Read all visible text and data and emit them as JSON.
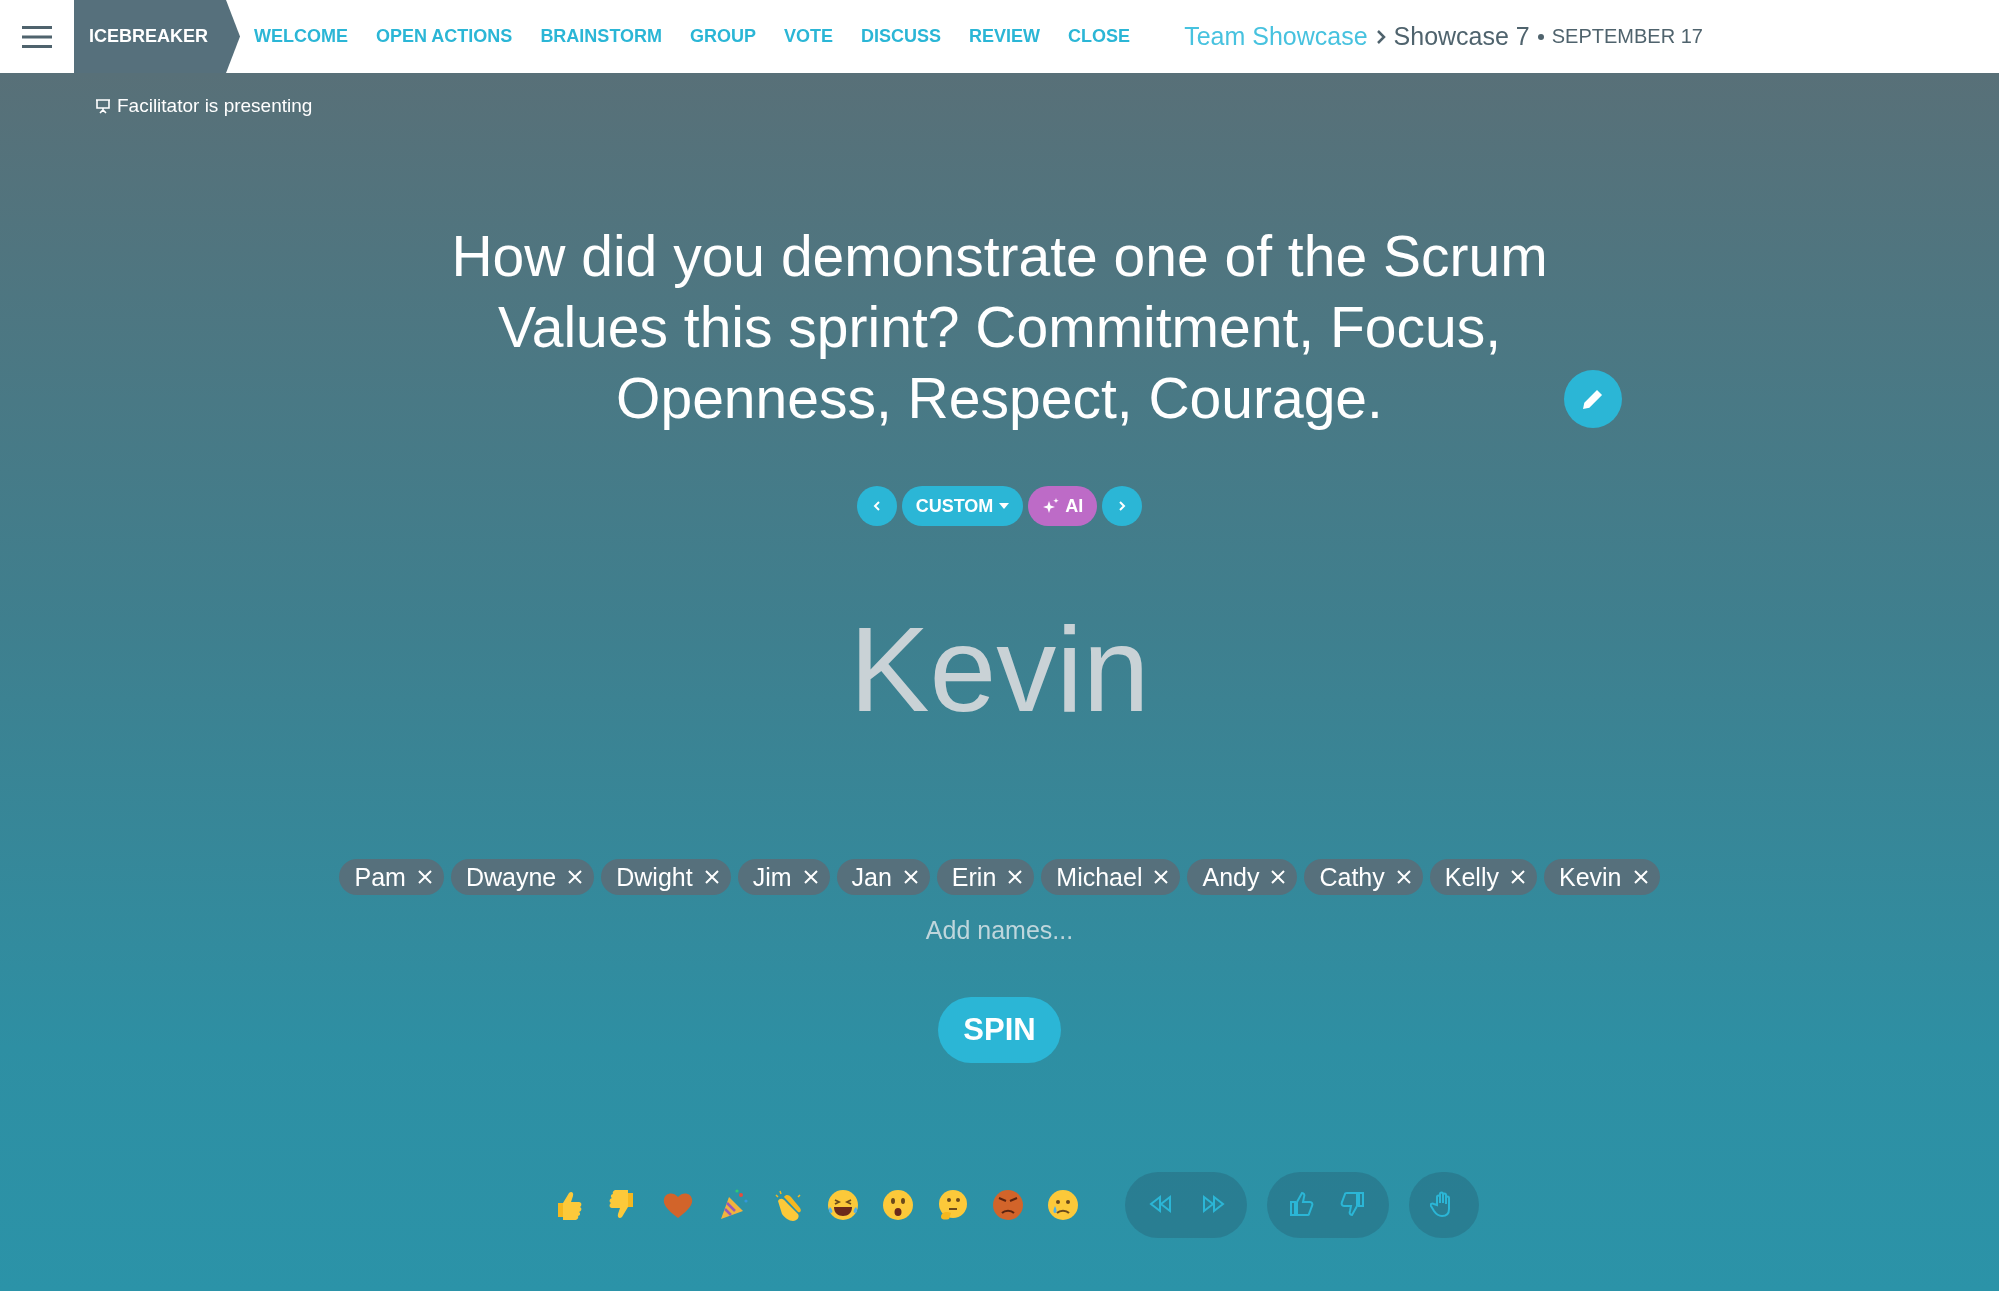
{
  "header": {
    "phases": [
      {
        "label": "ICEBREAKER",
        "selected": true
      },
      {
        "label": "WELCOME",
        "selected": false
      },
      {
        "label": "OPEN ACTIONS",
        "selected": false
      },
      {
        "label": "BRAINSTORM",
        "selected": false
      },
      {
        "label": "GROUP",
        "selected": false
      },
      {
        "label": "VOTE",
        "selected": false
      },
      {
        "label": "DISCUSS",
        "selected": false
      },
      {
        "label": "REVIEW",
        "selected": false
      },
      {
        "label": "CLOSE",
        "selected": false
      }
    ],
    "breadcrumb": {
      "team": "Team Showcase",
      "meeting": "Showcase 7",
      "date": "SEPTEMBER 17"
    }
  },
  "presenting": "Facilitator is presenting",
  "question": "How did you demonstrate one of the Scrum Values this sprint? Commitment, Focus, Openness, Respect, Courage.",
  "question_category": "CUSTOM",
  "ai_button": "AI",
  "spinner_result": "Kevin",
  "names": [
    "Pam",
    "Dwayne",
    "Dwight",
    "Jim",
    "Jan",
    "Erin",
    "Michael",
    "Andy",
    "Cathy",
    "Kelly",
    "Kevin"
  ],
  "names_field": {
    "placeholder": "Add names..."
  },
  "spin_button": "SPIN"
}
